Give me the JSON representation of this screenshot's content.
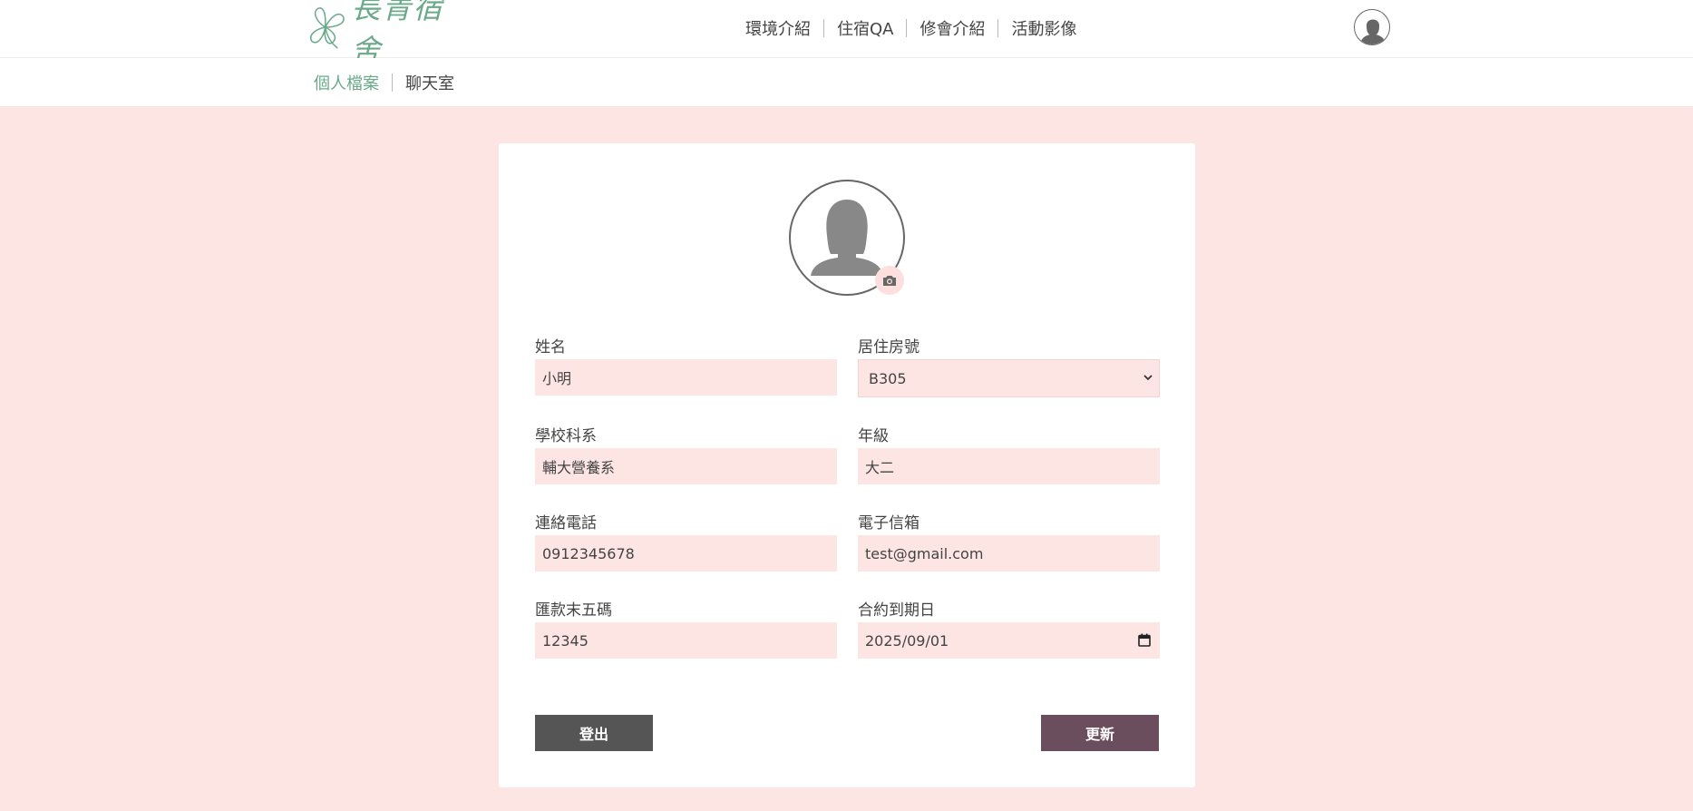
{
  "header": {
    "logo_text": "長青宿舍",
    "nav": [
      "環境介紹",
      "住宿QA",
      "修會介紹",
      "活動影像"
    ]
  },
  "subnav": {
    "items": [
      "個人檔案",
      "聊天室"
    ],
    "active_index": 0
  },
  "profile": {
    "fields": {
      "name": {
        "label": "姓名",
        "value": "小明"
      },
      "room": {
        "label": "居住房號",
        "value": "B305"
      },
      "department": {
        "label": "學校科系",
        "value": "輔大營養系"
      },
      "grade": {
        "label": "年級",
        "value": "大二"
      },
      "phone": {
        "label": "連絡電話",
        "value": "0912345678"
      },
      "email": {
        "label": "電子信箱",
        "value": "test@gmail.com"
      },
      "account_last5": {
        "label": "匯款末五碼",
        "value": "12345"
      },
      "contract_end": {
        "label": "合約到期日",
        "value": "2025/09/01"
      }
    },
    "buttons": {
      "logout": "登出",
      "update": "更新"
    }
  },
  "icons": {
    "logo": "clover-logo-icon",
    "user": "user-avatar-icon",
    "avatar": "female-avatar-placeholder",
    "camera": "camera-icon",
    "select": "chevron-down-icon",
    "date": "calendar-icon"
  },
  "colors": {
    "background": "#fde5e4",
    "accent_green": "#6aa98a",
    "input_bg": "#fde5e4",
    "logout_button": "#555555",
    "update_button": "#6b4e5e"
  }
}
